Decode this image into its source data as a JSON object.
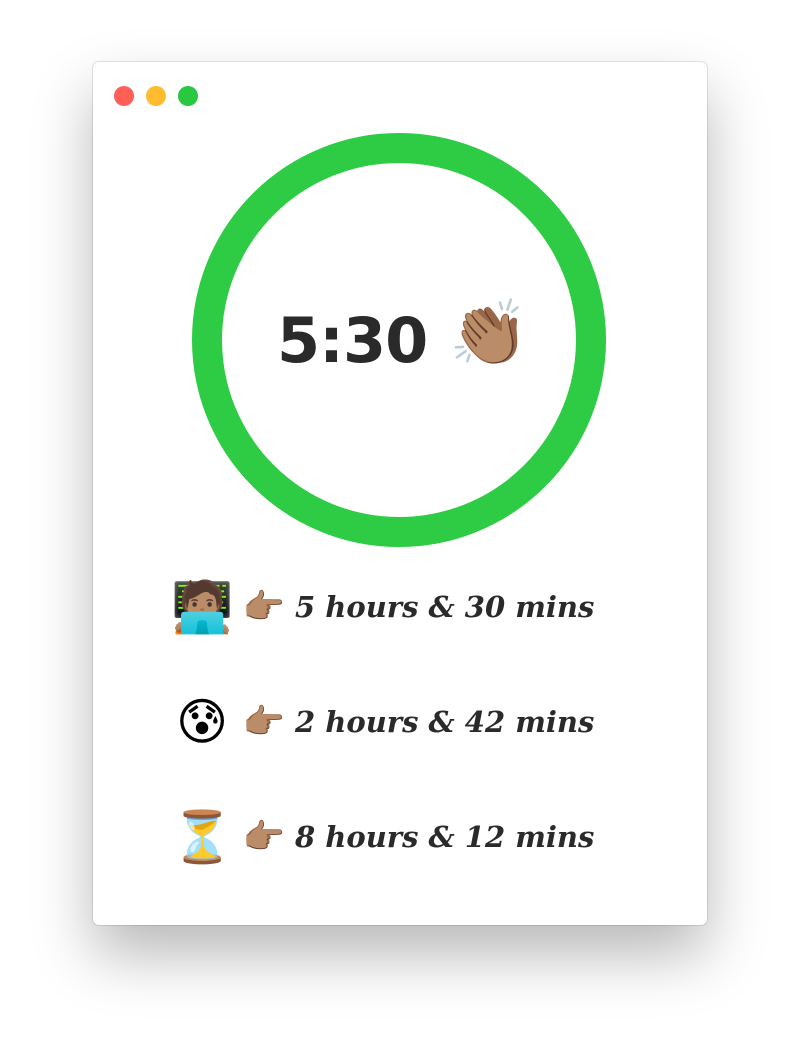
{
  "colors": {
    "ring": "#2ECC44",
    "close": "#FF5F57",
    "minimize": "#FEBC2E",
    "zoom": "#28C840",
    "text": "#2A2A2A"
  },
  "timer": {
    "display": "5:30",
    "celebration_emoji": "👏🏽",
    "progress": 1.0
  },
  "stats": [
    {
      "icon": "🧑🏽‍💻",
      "icon_name": "person-laptop-icon",
      "pointer": "👉🏽",
      "text": "5 hours & 30 mins"
    },
    {
      "icon": "😰",
      "icon_name": "anxious-sweat-face-icon",
      "pointer": "👉🏽",
      "text": "2 hours & 42 mins"
    },
    {
      "icon": "⏳",
      "icon_name": "hourglass-icon",
      "pointer": "👉🏽",
      "text": "8 hours & 12 mins"
    }
  ]
}
